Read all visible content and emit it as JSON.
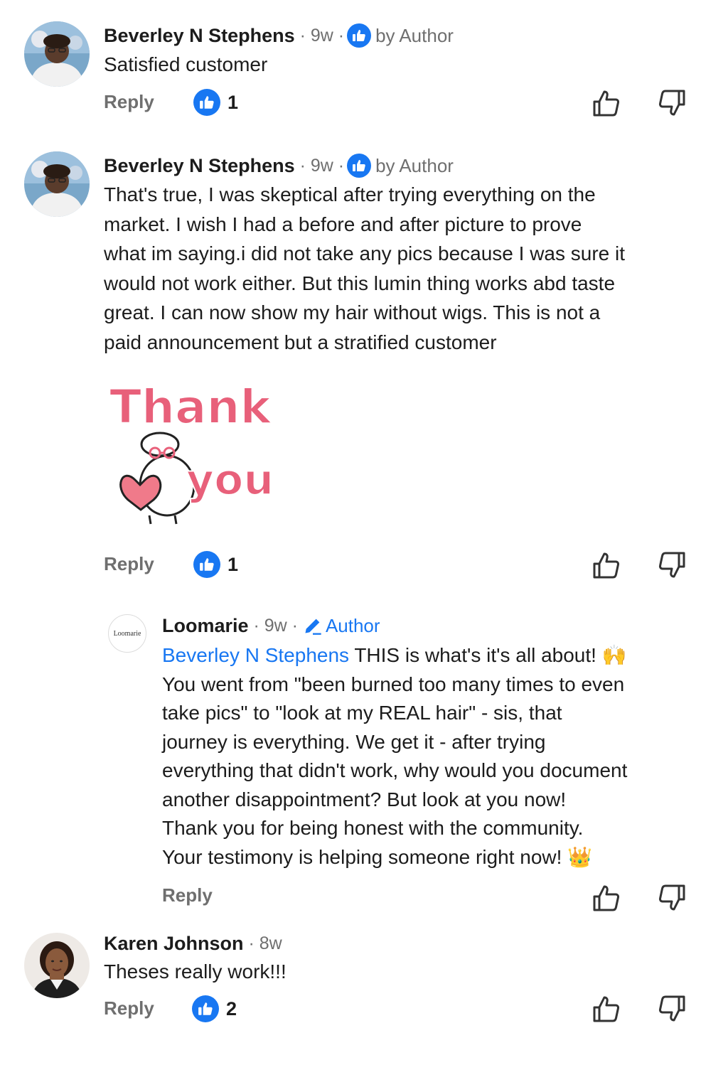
{
  "comments": [
    {
      "name": "Beverley N Stephens",
      "time": "9w",
      "badge_label": "by Author",
      "text": "Satisfied customer",
      "reply": "Reply",
      "likes": "1"
    },
    {
      "name": "Beverley N Stephens",
      "time": "9w",
      "badge_label": "by Author",
      "text_lines": [
        "That's true, I was skeptical after trying everything on the",
        "market. I wish I had a before and after picture to prove",
        "what im saying.i did not take any pics because I was sure it",
        "would not work either. But this lumin thing works abd taste",
        "great. I can now show my hair without wigs.  This is not a",
        "paid announcement but a stratified customer"
      ],
      "sticker_top": "Thank",
      "sticker_bottom": "you",
      "reply": "Reply",
      "likes": "1"
    },
    {
      "name": "Loomarie",
      "time": "9w",
      "badge_label": "Author",
      "logo_text": "Loomarie",
      "mention": "Beverley N Stephens",
      "first_line_rest": "THIS is what's it's all about! 🙌",
      "text_lines": [
        "You went from \"been burned too many times to even",
        "take pics\" to \"look at my REAL hair\" - sis, that",
        "journey is everything. We get it - after trying",
        "everything that didn't work, why would you document",
        "another disappointment? But look at you now!",
        "Thank you for being honest with the community.",
        "Your testimony is helping someone right now! 👑"
      ],
      "reply": "Reply"
    },
    {
      "name": "Karen Johnson",
      "time": "8w",
      "text": "Theses really work!!!",
      "reply": "Reply",
      "likes": "2"
    }
  ],
  "colors": {
    "accent": "#1877f2",
    "meta": "#6f6f6f",
    "sticker_text": "#e8607a",
    "sticker_heart": "#f07a8a"
  }
}
